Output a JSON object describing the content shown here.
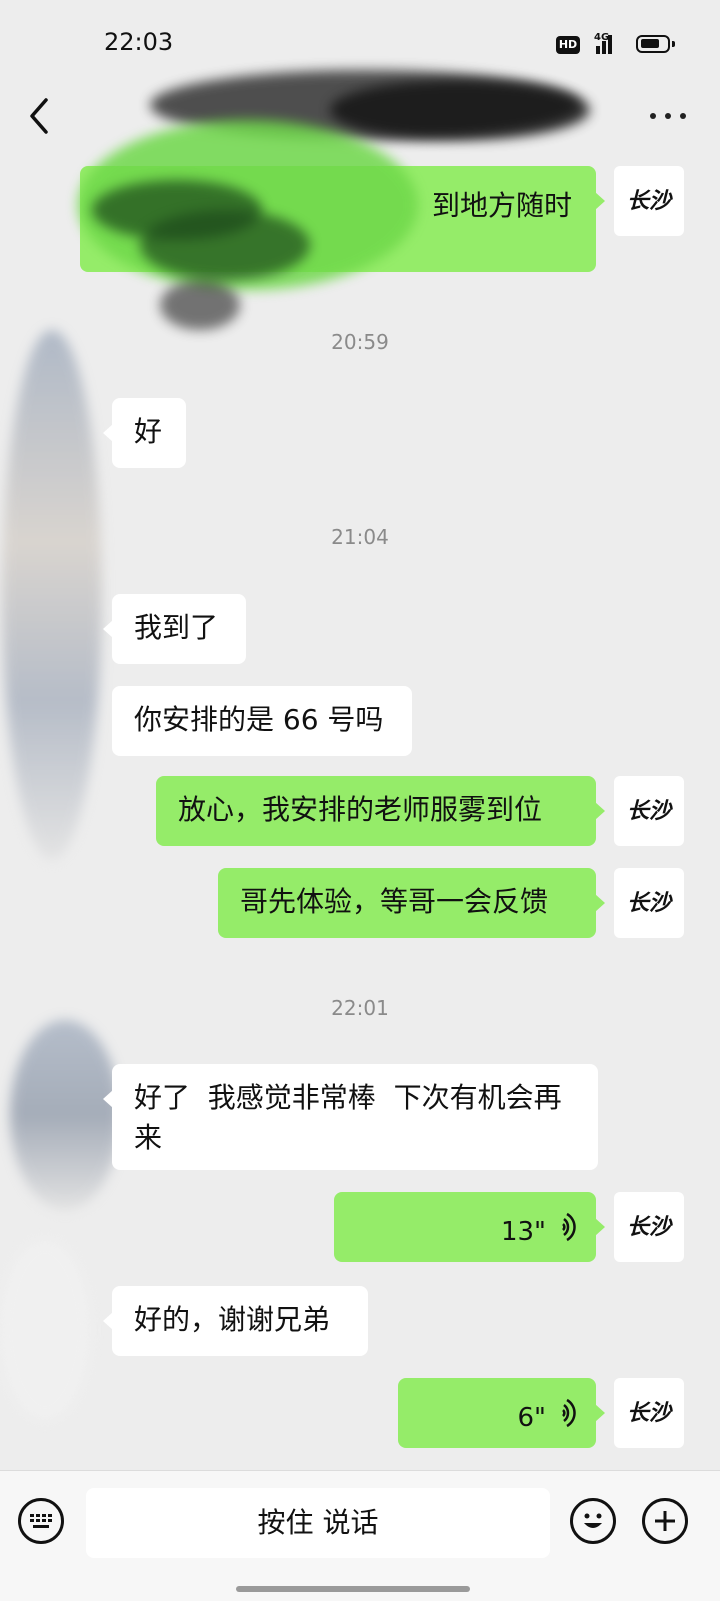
{
  "status_bar": {
    "time": "22:03",
    "hd": "HD",
    "network": "4G"
  },
  "nav": {
    "back_icon": "chevron-left-icon",
    "more_icon": "more-dots-icon"
  },
  "my_avatar_text": "长沙",
  "messages": [
    {
      "side": "me",
      "text": "到地方随时"
    },
    {
      "type": "time",
      "text": "20:59"
    },
    {
      "side": "other",
      "text": "好"
    },
    {
      "type": "time",
      "text": "21:04"
    },
    {
      "side": "other",
      "text": "我到了"
    },
    {
      "side": "other",
      "text": "你安排的是 66 号吗"
    },
    {
      "side": "me",
      "text": "放心，我安排的老师服雾到位"
    },
    {
      "side": "me",
      "text": "哥先体验，等哥一会反馈"
    },
    {
      "type": "time",
      "text": "22:01"
    },
    {
      "side": "other",
      "text_line1": "好了  我感觉非常棒  下次有机会再",
      "text_line2": "来"
    },
    {
      "side": "me",
      "type": "voice",
      "duration": "13\""
    },
    {
      "side": "other",
      "text": "好的，谢谢兄弟"
    },
    {
      "side": "me",
      "type": "voice",
      "duration": "6\""
    }
  ],
  "input_bar": {
    "talk_label": "按住 说话",
    "left_icon": "keyboard-icon",
    "emoji_icon": "emoji-icon",
    "plus_icon": "plus-icon"
  },
  "colors": {
    "my_bubble": "#95ec69",
    "other_bubble": "#ffffff",
    "background": "#ededed"
  }
}
